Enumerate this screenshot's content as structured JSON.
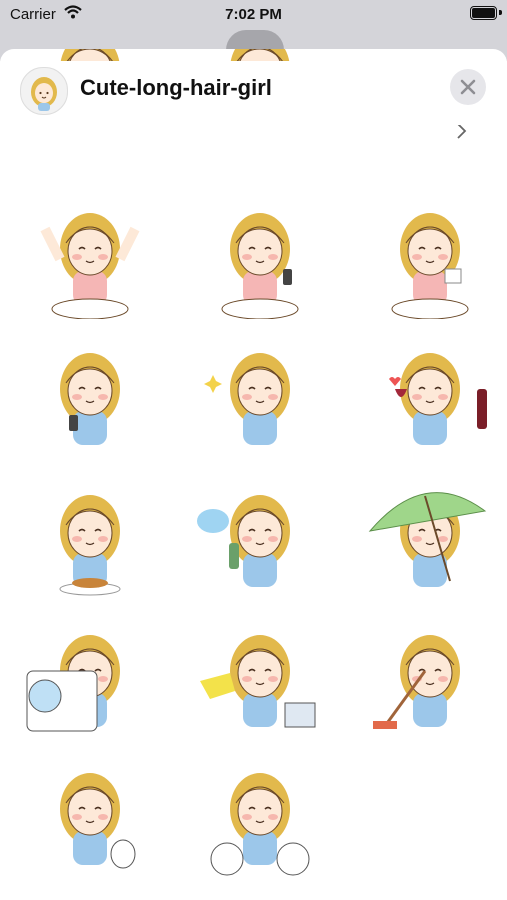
{
  "status_bar": {
    "carrier": "Carrier",
    "time": "7:02 PM"
  },
  "header": {
    "title": "Cute-long-hair-girl",
    "app_icon": "girl-sticker-icon",
    "close_icon": "close-icon"
  },
  "stickers": [
    {
      "name": "sticker-partial-1"
    },
    {
      "name": "sticker-partial-2"
    },
    {
      "name": "sticker-stretch-wakeup"
    },
    {
      "name": "sticker-yawn-phone"
    },
    {
      "name": "sticker-sleepy-tissue"
    },
    {
      "name": "sticker-phone-call"
    },
    {
      "name": "sticker-praying"
    },
    {
      "name": "sticker-wine"
    },
    {
      "name": "sticker-eating-pancakes"
    },
    {
      "name": "sticker-spray"
    },
    {
      "name": "sticker-umbrella-rain"
    },
    {
      "name": "sticker-laundry"
    },
    {
      "name": "sticker-folding-clothes"
    },
    {
      "name": "sticker-mopping"
    },
    {
      "name": "sticker-trash-bag"
    },
    {
      "name": "sticker-two-trash-bags"
    }
  ],
  "colors": {
    "hair": "#e2b94c",
    "shirt": "#9cc7ea",
    "skin": "#fde9d8",
    "blush": "#f6b7ae",
    "pink_shirt": "#f5b6b5"
  }
}
